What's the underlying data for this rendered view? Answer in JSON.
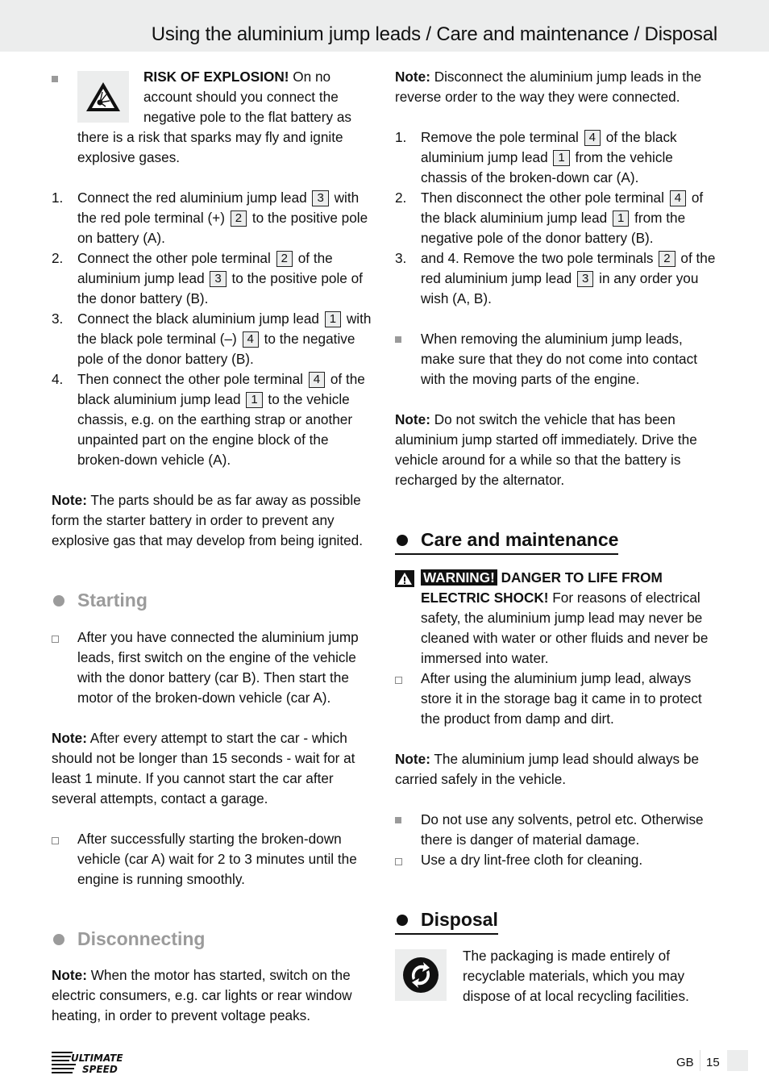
{
  "header": {
    "title": "Using the aluminium jump leads / Care and maintenance / Disposal"
  },
  "left": {
    "explosion": {
      "icon": "explosion-warning-icon",
      "bold": "RISK OF EXPLOSION!",
      "text": " On no account should you connect the negative pole to the flat battery as there is a risk that sparks may fly and ignite explosive gases."
    },
    "steps": [
      {
        "num": "1.",
        "parts": [
          "Connect the red aluminium jump lead ",
          "3",
          " with the red pole terminal (+) ",
          "2",
          " to the positive pole on battery (A)."
        ]
      },
      {
        "num": "2.",
        "parts": [
          "Connect the other pole terminal ",
          "2",
          " of the aluminium jump lead ",
          "3",
          " to the positive pole of the donor battery (B)."
        ]
      },
      {
        "num": "3.",
        "parts": [
          "Connect the black aluminium jump lead ",
          "1",
          " with the black pole terminal (–) ",
          "4",
          " to the negative pole of the donor battery (B)."
        ]
      },
      {
        "num": "4.",
        "parts": [
          "Then connect the other pole terminal ",
          "4",
          " of the black aluminium jump lead ",
          "1",
          " to the vehicle chassis, e.g. on the earthing strap or another unpainted part on the engine block of the broken-down vehicle (A)."
        ]
      }
    ],
    "note1": {
      "label": "Note:",
      "text": " The parts should be as far away as possible form the starter battery in order to prevent any explosive gas that may develop from being ignited."
    },
    "starting": {
      "heading": "Starting",
      "item1": "After you have connected the aluminium jump leads, first switch on the engine of the vehicle with the donor battery (car B). Then start the motor of the broken-down vehicle (car A).",
      "note": {
        "label": "Note:",
        "text": " After every attempt to start the car - which should not be longer than 15 seconds - wait for at least 1 minute. If you cannot start the car after several attempts, contact a garage."
      },
      "item2": "After successfully starting the broken-down vehicle (car A) wait for 2 to 3 minutes until the engine is running smoothly."
    },
    "disconnecting": {
      "heading": "Disconnecting",
      "note": {
        "label": "Note:",
        "text": " When the motor has started, switch on the electric consumers, e.g. car lights or rear window heating, in order to prevent voltage peaks."
      }
    }
  },
  "right": {
    "note1": {
      "label": "Note:",
      "text": " Disconnect the aluminium jump leads in the reverse order to the way they were connected."
    },
    "steps": [
      {
        "num": "1.",
        "parts": [
          "Remove the pole terminal ",
          "4",
          " of the black aluminium jump lead ",
          "1",
          " from the vehicle chassis of the broken-down car (A)."
        ]
      },
      {
        "num": "2.",
        "parts": [
          "Then disconnect the other pole terminal ",
          "4",
          " of the black aluminium jump lead ",
          "1",
          " from the negative pole of the donor battery (B)."
        ]
      },
      {
        "num": "3.",
        "parts": [
          "and 4. Remove the two pole terminals ",
          "2",
          " of the red aluminium jump lead ",
          "3",
          " in any order you wish (A, B)."
        ]
      }
    ],
    "removing_item": "When removing the aluminium jump leads, make sure that they do not come into contact with the moving parts of the engine.",
    "note2": {
      "label": "Note:",
      "text": " Do not switch the vehicle that has been aluminium jump started off immediately. Drive the vehicle around for a while so that the battery is recharged by the alternator."
    },
    "care": {
      "heading": "Care and maintenance",
      "warning": {
        "badge": "WARNING!",
        "bold": " DANGER TO LIFE FROM ELECTRIC SHOCK!",
        "text": " For reasons of electrical safety, the aluminium jump lead may never be cleaned with water or other fluids and never be immersed into water."
      },
      "item1": "After using the aluminium jump lead, always store it in the storage bag it came in to protect the product from damp and dirt.",
      "note": {
        "label": "Note:",
        "text": " The aluminium jump lead should always be carried safely in the vehicle."
      },
      "item2": "Do not use any solvents, petrol etc. Otherwise there is danger of material damage.",
      "item3": "Use a dry lint-free cloth for cleaning."
    },
    "disposal": {
      "heading": "Disposal",
      "text": "The packaging is made entirely of recyclable materials, which you may dispose of at local recycling facilities."
    }
  },
  "footer": {
    "logo_line1": "ULTIMATE",
    "logo_line2": "SPEED",
    "lang": "GB",
    "page": "15"
  }
}
